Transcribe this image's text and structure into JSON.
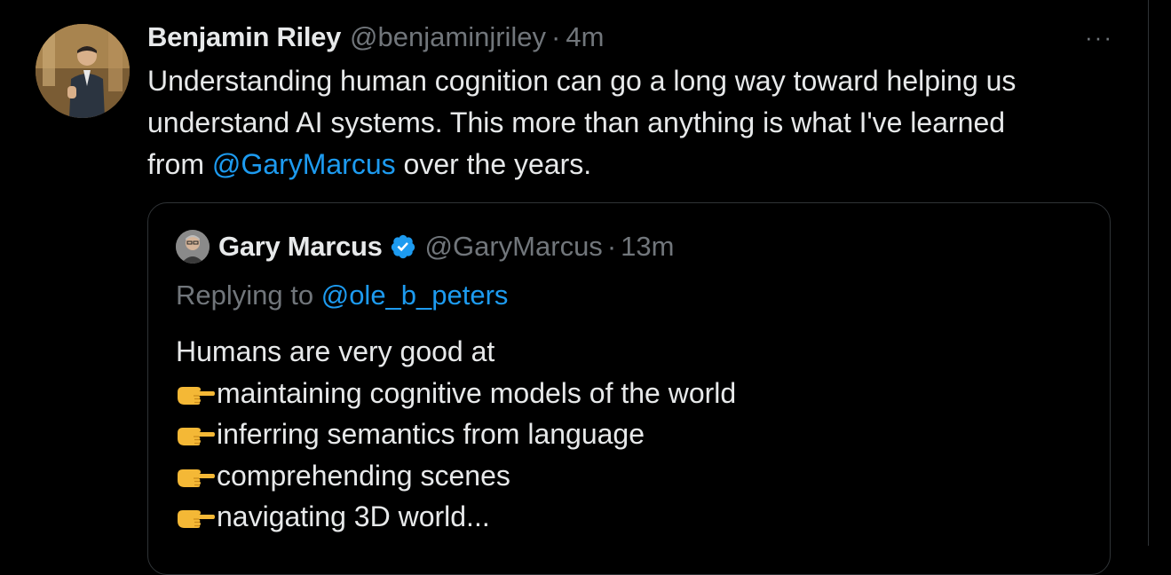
{
  "tweet": {
    "author_name": "Benjamin Riley",
    "author_handle": "@benjaminjriley",
    "separator": "·",
    "timestamp": "4m",
    "more_label": "···",
    "text_line1": "Understanding human cognition can go a long way toward helping us",
    "text_line2": "understand AI systems. This more than anything is what I've learned",
    "text_line3_prefix": "from ",
    "text_mention": "@GaryMarcus",
    "text_line3_suffix": " over the years."
  },
  "quote": {
    "author_name": "Gary Marcus",
    "verified": true,
    "author_handle": "@GaryMarcus",
    "separator": "·",
    "timestamp": "13m",
    "replying_prefix": "Replying to ",
    "replying_to": "@ole_b_peters",
    "intro": "Humans are very good at",
    "bullet_icon": "pointing-hand-icon",
    "bullets": [
      "maintaining cognitive models of the world",
      "inferring semantics from language",
      "comprehending scenes",
      "navigating 3D world..."
    ]
  },
  "colors": {
    "background": "#000000",
    "primary_text": "#e7e9ea",
    "secondary_text": "#71767b",
    "link": "#1d9bf0",
    "border": "#2f3336",
    "verified": "#1d9bf0",
    "emoji": "#f4b836"
  }
}
